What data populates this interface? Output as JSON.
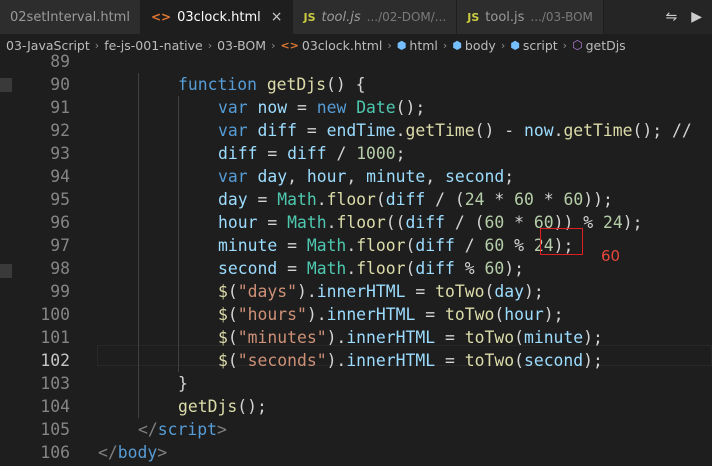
{
  "tabs": [
    {
      "name": "02setInterval.html",
      "hint": "",
      "icon": "none",
      "active": false,
      "italic": false,
      "closable": false
    },
    {
      "name": "03clock.html",
      "hint": "",
      "icon": "html",
      "active": true,
      "italic": false,
      "closable": true
    },
    {
      "name": "tool.js",
      "hint": ".../02-DOM/...",
      "icon": "js",
      "active": false,
      "italic": true,
      "closable": false
    },
    {
      "name": "tool.js",
      "hint": ".../03-BOM",
      "icon": "js",
      "active": false,
      "italic": false,
      "closable": false
    }
  ],
  "tab_icons": {
    "html": "<>",
    "js": "JS",
    "close": "×",
    "compare": "⇋",
    "run": "▶"
  },
  "breadcrumb": {
    "items": [
      "03-JavaScript",
      "fe-js-001-native",
      "03-BOM",
      "03clock.html",
      "html",
      "body",
      "script",
      "getDjs"
    ],
    "separator": "›"
  },
  "editor": {
    "current_line": 102,
    "lines": [
      {
        "num": "89",
        "indent": 0,
        "tokens": []
      },
      {
        "num": "90",
        "indent": 8,
        "tokens": [
          [
            "k",
            "function "
          ],
          [
            "f",
            "getDjs"
          ],
          [
            "p",
            "() {"
          ]
        ]
      },
      {
        "num": "91",
        "indent": 12,
        "tokens": [
          [
            "k",
            "var "
          ],
          [
            "v",
            "now"
          ],
          [
            "p",
            " = "
          ],
          [
            "k",
            "new "
          ],
          [
            "c",
            "Date"
          ],
          [
            "p",
            "();"
          ]
        ]
      },
      {
        "num": "92",
        "indent": 12,
        "tokens": [
          [
            "k",
            "var "
          ],
          [
            "v",
            "diff"
          ],
          [
            "p",
            " = "
          ],
          [
            "v",
            "endTime"
          ],
          [
            "p",
            "."
          ],
          [
            "f",
            "getTime"
          ],
          [
            "p",
            "() - "
          ],
          [
            "v",
            "now"
          ],
          [
            "p",
            "."
          ],
          [
            "f",
            "getTime"
          ],
          [
            "p",
            "(); //"
          ]
        ]
      },
      {
        "num": "93",
        "indent": 12,
        "tokens": [
          [
            "v",
            "diff"
          ],
          [
            "p",
            " = "
          ],
          [
            "v",
            "diff"
          ],
          [
            "p",
            " / "
          ],
          [
            "n",
            "1000"
          ],
          [
            "p",
            ";"
          ]
        ]
      },
      {
        "num": "94",
        "indent": 12,
        "tokens": [
          [
            "k",
            "var "
          ],
          [
            "v",
            "day"
          ],
          [
            "p",
            ", "
          ],
          [
            "v",
            "hour"
          ],
          [
            "p",
            ", "
          ],
          [
            "v",
            "minute"
          ],
          [
            "p",
            ", "
          ],
          [
            "v",
            "second"
          ],
          [
            "p",
            ";"
          ]
        ]
      },
      {
        "num": "95",
        "indent": 12,
        "tokens": [
          [
            "v",
            "day"
          ],
          [
            "p",
            " = "
          ],
          [
            "c",
            "Math"
          ],
          [
            "p",
            "."
          ],
          [
            "f",
            "floor"
          ],
          [
            "p",
            "("
          ],
          [
            "v",
            "diff"
          ],
          [
            "p",
            " / ("
          ],
          [
            "n",
            "24"
          ],
          [
            "p",
            " * "
          ],
          [
            "n",
            "60"
          ],
          [
            "p",
            " * "
          ],
          [
            "n",
            "60"
          ],
          [
            "p",
            "));"
          ]
        ]
      },
      {
        "num": "96",
        "indent": 12,
        "tokens": [
          [
            "v",
            "hour"
          ],
          [
            "p",
            " = "
          ],
          [
            "c",
            "Math"
          ],
          [
            "p",
            "."
          ],
          [
            "f",
            "floor"
          ],
          [
            "p",
            "(("
          ],
          [
            "v",
            "diff"
          ],
          [
            "p",
            " / ("
          ],
          [
            "n",
            "60"
          ],
          [
            "p",
            " * "
          ],
          [
            "n",
            "60"
          ],
          [
            "p",
            ")) % "
          ],
          [
            "n",
            "24"
          ],
          [
            "p",
            ");"
          ]
        ]
      },
      {
        "num": "97",
        "indent": 12,
        "tokens": [
          [
            "v",
            "minute"
          ],
          [
            "p",
            " = "
          ],
          [
            "c",
            "Math"
          ],
          [
            "p",
            "."
          ],
          [
            "f",
            "floor"
          ],
          [
            "p",
            "("
          ],
          [
            "v",
            "diff"
          ],
          [
            "p",
            " / "
          ],
          [
            "n",
            "60"
          ],
          [
            "p",
            " % "
          ],
          [
            "n",
            "24"
          ],
          [
            "p",
            ");"
          ]
        ]
      },
      {
        "num": "98",
        "indent": 12,
        "tokens": [
          [
            "v",
            "second"
          ],
          [
            "p",
            " = "
          ],
          [
            "c",
            "Math"
          ],
          [
            "p",
            "."
          ],
          [
            "f",
            "floor"
          ],
          [
            "p",
            "("
          ],
          [
            "v",
            "diff"
          ],
          [
            "p",
            " % "
          ],
          [
            "n",
            "60"
          ],
          [
            "p",
            ");"
          ]
        ]
      },
      {
        "num": "99",
        "indent": 12,
        "tokens": [
          [
            "f",
            "$"
          ],
          [
            "p",
            "("
          ],
          [
            "s",
            "\"days\""
          ],
          [
            "p",
            ")."
          ],
          [
            "v",
            "innerHTML"
          ],
          [
            "p",
            " = "
          ],
          [
            "f",
            "toTwo"
          ],
          [
            "p",
            "("
          ],
          [
            "v",
            "day"
          ],
          [
            "p",
            ");"
          ]
        ]
      },
      {
        "num": "100",
        "indent": 12,
        "tokens": [
          [
            "f",
            "$"
          ],
          [
            "p",
            "("
          ],
          [
            "s",
            "\"hours\""
          ],
          [
            "p",
            ")."
          ],
          [
            "v",
            "innerHTML"
          ],
          [
            "p",
            " = "
          ],
          [
            "f",
            "toTwo"
          ],
          [
            "p",
            "("
          ],
          [
            "v",
            "hour"
          ],
          [
            "p",
            ");"
          ]
        ]
      },
      {
        "num": "101",
        "indent": 12,
        "tokens": [
          [
            "f",
            "$"
          ],
          [
            "p",
            "("
          ],
          [
            "s",
            "\"minutes\""
          ],
          [
            "p",
            ")."
          ],
          [
            "v",
            "innerHTML"
          ],
          [
            "p",
            " = "
          ],
          [
            "f",
            "toTwo"
          ],
          [
            "p",
            "("
          ],
          [
            "v",
            "minute"
          ],
          [
            "p",
            ");"
          ]
        ]
      },
      {
        "num": "102",
        "indent": 12,
        "tokens": [
          [
            "f",
            "$"
          ],
          [
            "p",
            "("
          ],
          [
            "s",
            "\"seconds\""
          ],
          [
            "p",
            ")."
          ],
          [
            "v",
            "innerHTML"
          ],
          [
            "p",
            " = "
          ],
          [
            "f",
            "toTwo"
          ],
          [
            "p",
            "("
          ],
          [
            "v",
            "second"
          ],
          [
            "p",
            ");"
          ]
        ]
      },
      {
        "num": "103",
        "indent": 8,
        "tokens": [
          [
            "p",
            "}"
          ]
        ]
      },
      {
        "num": "104",
        "indent": 8,
        "tokens": [
          [
            "f",
            "getDjs"
          ],
          [
            "p",
            "();"
          ]
        ]
      },
      {
        "num": "105",
        "indent": 4,
        "tokens": [
          [
            "t",
            "</"
          ],
          [
            "tag",
            "script"
          ],
          [
            "t",
            ">"
          ]
        ]
      },
      {
        "num": "106",
        "indent": 0,
        "tokens": [
          [
            "t",
            "</"
          ],
          [
            "tag",
            "body"
          ],
          [
            "t",
            ">"
          ]
        ]
      }
    ]
  },
  "annotation": {
    "text": "60",
    "color": "#e02020"
  }
}
